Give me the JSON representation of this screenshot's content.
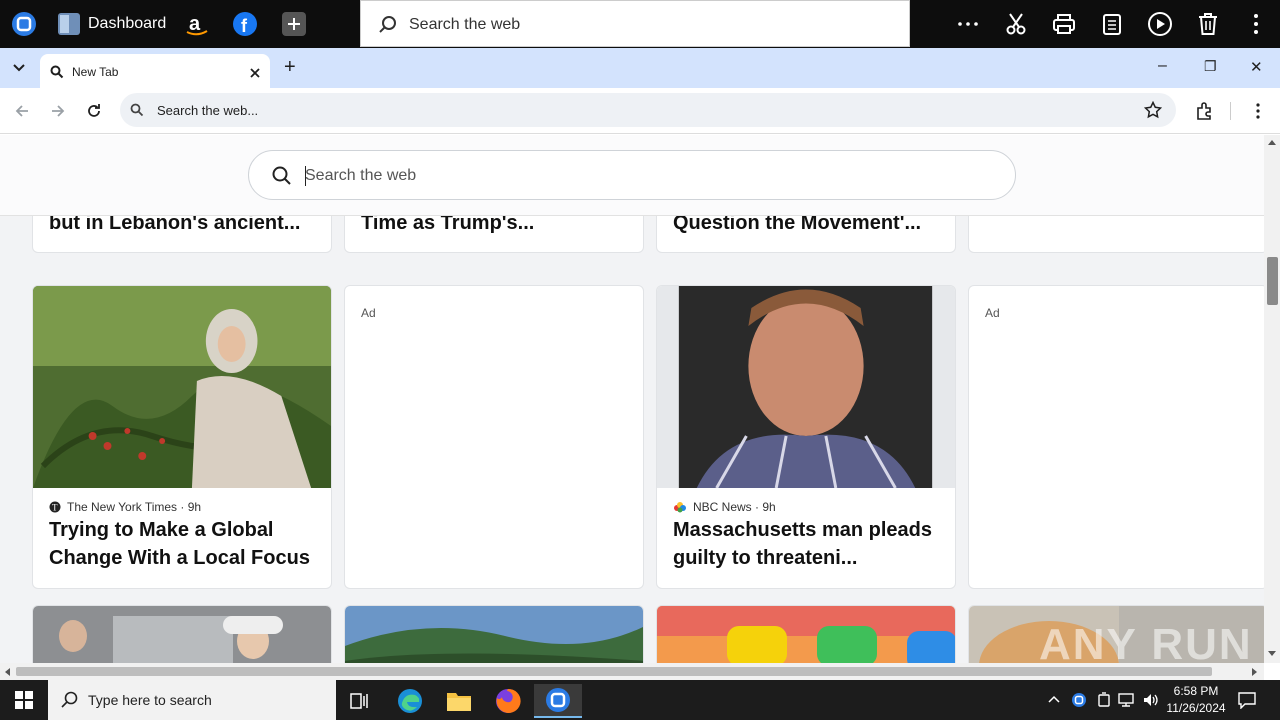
{
  "topbar": {
    "dashboard_label": "Dashboard",
    "search_placeholder": "Search the web",
    "icons": [
      "app-icon",
      "dashboard-icon",
      "amazon-icon",
      "facebook-icon",
      "plus-icon",
      "more-icon",
      "cut-icon",
      "print-icon",
      "clipboard-icon",
      "play-icon",
      "trash-icon",
      "menu-icon"
    ]
  },
  "tab": {
    "title": "New Tab",
    "new_tab": "+"
  },
  "window": {
    "minimize": "–",
    "restore": "❐",
    "close": "✕"
  },
  "omnibox": {
    "text": "Search the web..."
  },
  "page": {
    "search_placeholder": "Search the web",
    "row1": [
      {
        "headline": "but in Lebanon's ancient..."
      },
      {
        "headline": "Time as Trump's..."
      },
      {
        "headline": "Question the Movement'..."
      },
      {
        "headline": ""
      }
    ],
    "row2": [
      {
        "source": "The New York Times · 9h",
        "headline": "Trying to Make a Global Change With a Local Focus"
      },
      {
        "ad": "Ad"
      },
      {
        "source": "NBC News · 9h",
        "headline": "Massachusetts man pleads guilty to threateni..."
      },
      {
        "ad": "Ad"
      }
    ],
    "watermark": "ANY RUN"
  },
  "taskbar": {
    "search_placeholder": "Type here to search",
    "time": "6:58 PM",
    "date": "11/26/2024"
  }
}
